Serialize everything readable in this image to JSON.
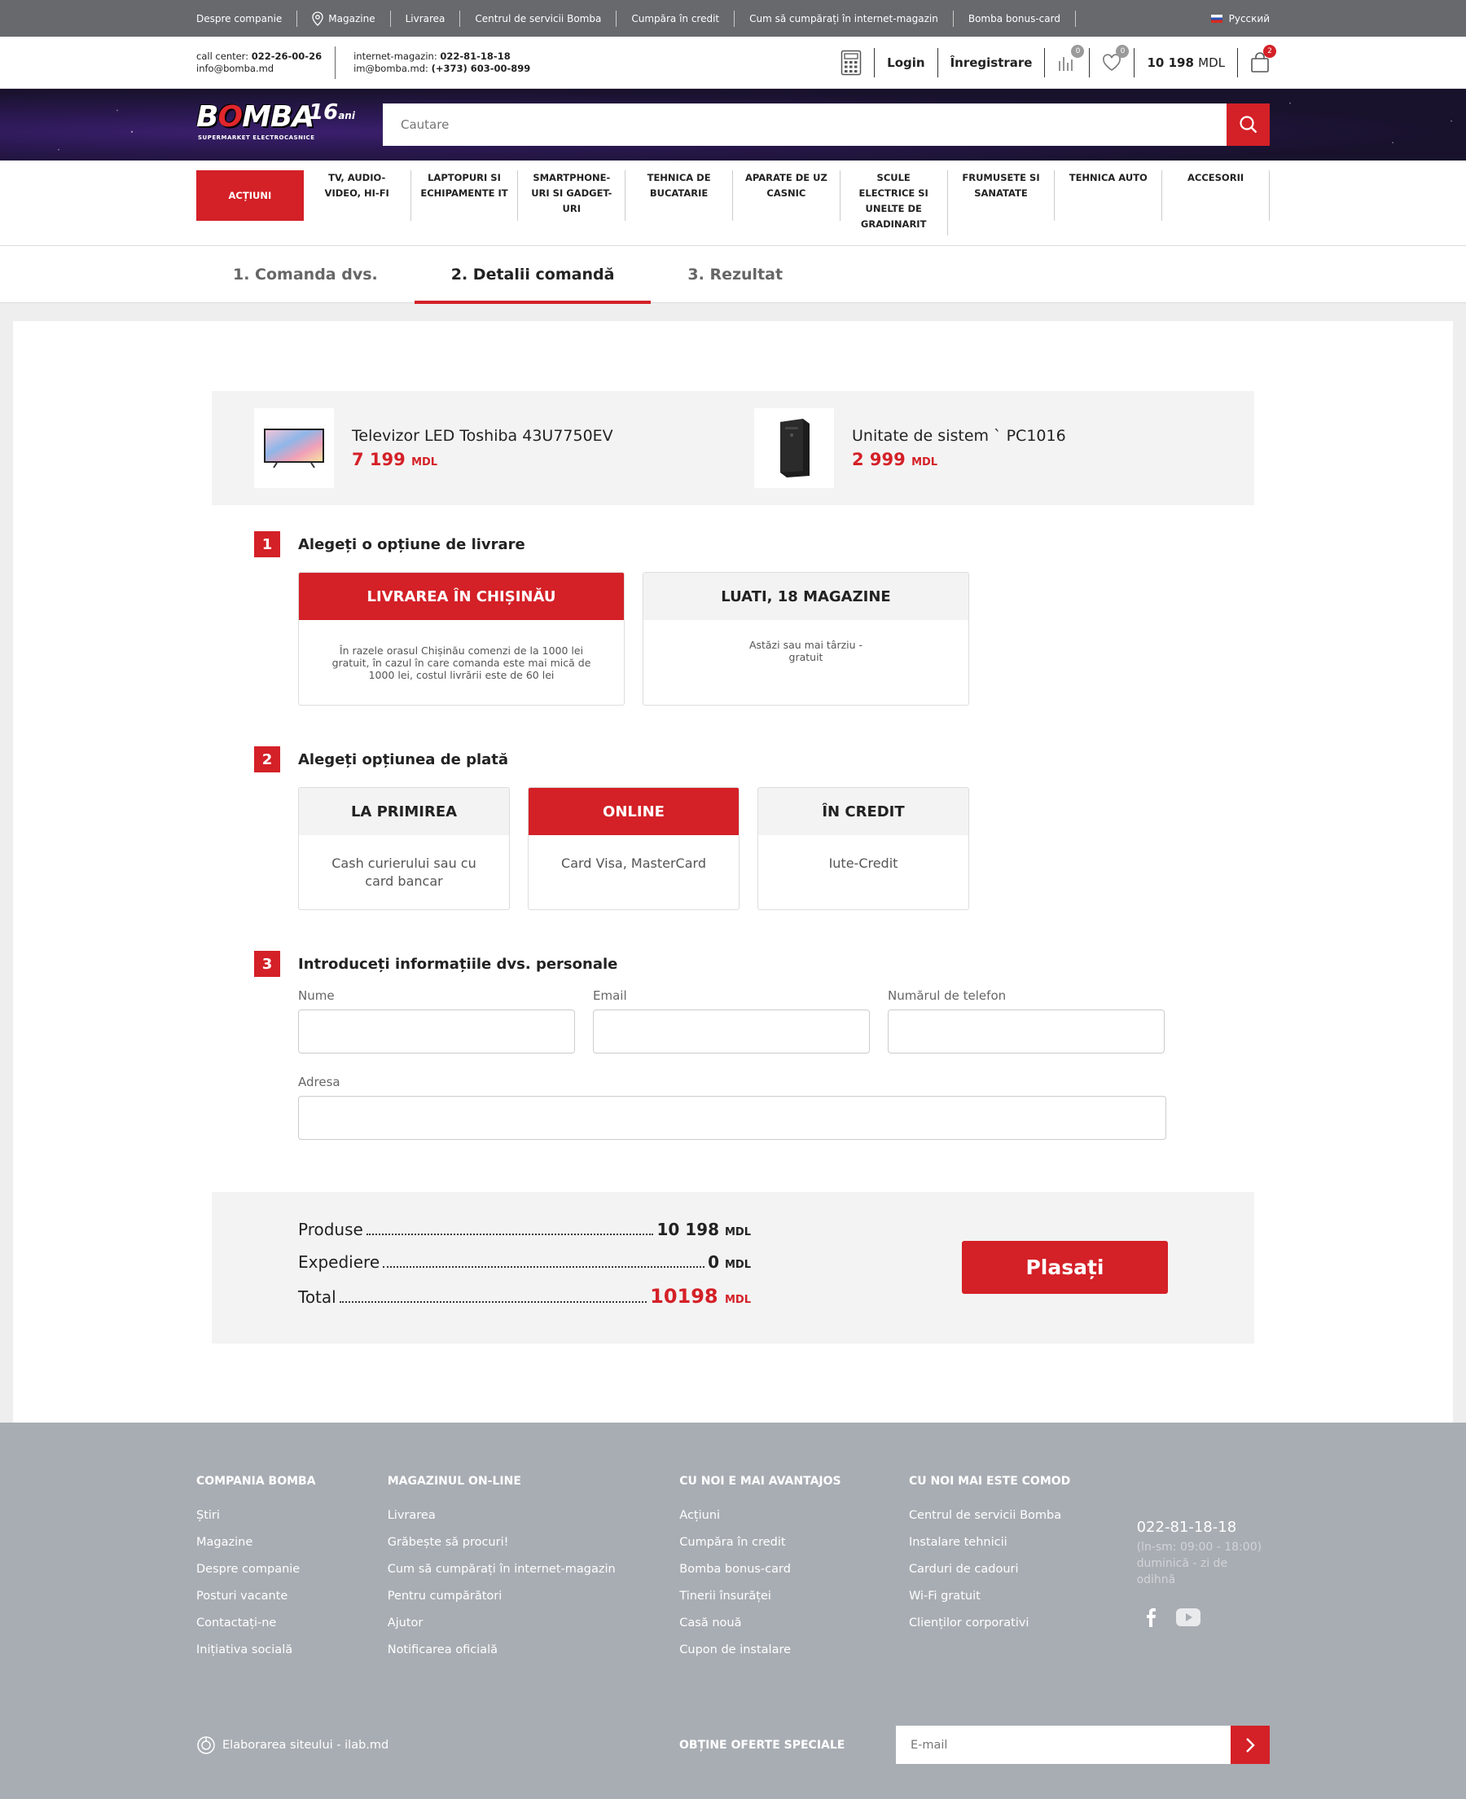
{
  "topbar": {
    "links": [
      "Despre companie",
      "Magazine",
      "Livrarea",
      "Centrul de servicii Bomba",
      "Cumpăra în credit",
      "Cum să cumpărați în internet-magazin",
      "Bomba bonus-card"
    ],
    "language": "Русский"
  },
  "contacts": {
    "callcenter_label": "call center:",
    "callcenter_phone": "022-26-00-26",
    "email": "info@bomba.md",
    "shop_label": "internet-magazin:",
    "shop_phone": "022-81-18-18",
    "shop_email_label": "im@bomba.md:",
    "shop_mobile": "(+373) 603-00-899"
  },
  "header": {
    "login": "Login",
    "register": "Înregistrare",
    "compare_count": "0",
    "wishlist_count": "0",
    "balance_value": "10 198",
    "balance_currency": "MDL",
    "cart_count": "2"
  },
  "logo": {
    "text_b": "B",
    "text_o": "O",
    "text_rest": "MBA",
    "sup": "16",
    "sup_small": "ani",
    "sub": "SUPERMARKET ELECTROCASNICE"
  },
  "search": {
    "placeholder": "Cautare"
  },
  "categories": [
    "ACȚIUNI",
    "TV, AUDIO-VIDEO, HI-FI",
    "LAPTOPURI SI ECHIPAMENTE IT",
    "SMARTPHONE-URI SI GADGET-URI",
    "TEHNICA DE BUCATARIE",
    "APARATE DE UZ CASNIC",
    "SCULE ELECTRICE SI UNELTE DE GRADINARIT",
    "FRUMUSETE SI SANATATE",
    "TEHNICA AUTO",
    "ACCESORII"
  ],
  "steps": [
    "1. Comanda dvs.",
    "2. Detalii comandă",
    "3. Rezultat"
  ],
  "cart": {
    "items": [
      {
        "name": "Televizor LED Toshiba 43U7750EV",
        "price": "7 199",
        "currency": "MDL"
      },
      {
        "name": "Unitate de sistem ` PC1016",
        "price": "2 999",
        "currency": "MDL"
      }
    ]
  },
  "delivery": {
    "num": "1",
    "title": "Alegeți o opțiune de livrare",
    "options": [
      {
        "title": "LIVRAREA ÎN CHIȘINĂU",
        "desc": "În razele orasul Chișinău comenzi de la 1000 lei gratuit, în cazul în care comanda este mai mică de 1000 lei, costul livrării este de 60 lei"
      },
      {
        "title": "LUATI, 18 MAGAZINE",
        "desc": "Astăzi sau mai târziu - gratuit"
      }
    ]
  },
  "payment": {
    "num": "2",
    "title": "Alegeți opțiunea de plată",
    "options": [
      {
        "title": "LA PRIMIREA",
        "desc": "Cash curierului sau cu card bancar"
      },
      {
        "title": "ONLINE",
        "desc": "Card Visa, MasterCard"
      },
      {
        "title": "ÎN CREDIT",
        "desc": "Iute-Credit"
      }
    ]
  },
  "personal": {
    "num": "3",
    "title": "Introduceți informațiile dvs. personale",
    "name_label": "Nume",
    "email_label": "Email",
    "phone_label": "Numărul de telefon",
    "address_label": "Adresa"
  },
  "summary": {
    "products_label": "Produse",
    "products_value": "10 198",
    "shipping_label": "Expediere",
    "shipping_value": "0",
    "total_label": "Total",
    "total_value": "10198",
    "currency": "MDL",
    "place_button": "Plasați"
  },
  "footer": {
    "columns": [
      {
        "title": "COMPANIA BOMBA",
        "links": [
          "Știri",
          "Magazine",
          "Despre companie",
          "Posturi vacante",
          "Contactați-ne",
          "Inițiativa socială"
        ]
      },
      {
        "title": "MAGAZINUL ON-LINE",
        "links": [
          "Livrarea",
          "Grăbește să procuri!",
          "Cum să cumpărați în internet-magazin",
          "Pentru cumpărători",
          "Ajutor",
          "Notificarea oficială"
        ]
      },
      {
        "title": "CU NOI E MAI AVANTAJOS",
        "links": [
          "Acțiuni",
          "Cumpăra în credit",
          "Bomba bonus-card",
          "Tinerii însurăței",
          "Casă nouă",
          "Cupon de instalare"
        ]
      },
      {
        "title": "CU NOI MAI ESTE COMOD",
        "links": [
          "Centrul de servicii Bomba",
          "Instalare tehnicii",
          "Carduri de cadouri",
          "Wi-Fi gratuit",
          "Clienților corporativi"
        ]
      }
    ],
    "phone": "022-81-18-18",
    "hours1": "(ln-sm: 09:00 - 18:00)",
    "hours2": "duminică - zi de odihnă",
    "developer": "Elaborarea siteului - ilab.md",
    "offers_label": "OBȚINE OFERTE SPECIALE",
    "email_placeholder": "E-mail"
  },
  "colors": {
    "accent": "#d42027",
    "topbar": "#67696c",
    "footer": "#a8adb3"
  }
}
